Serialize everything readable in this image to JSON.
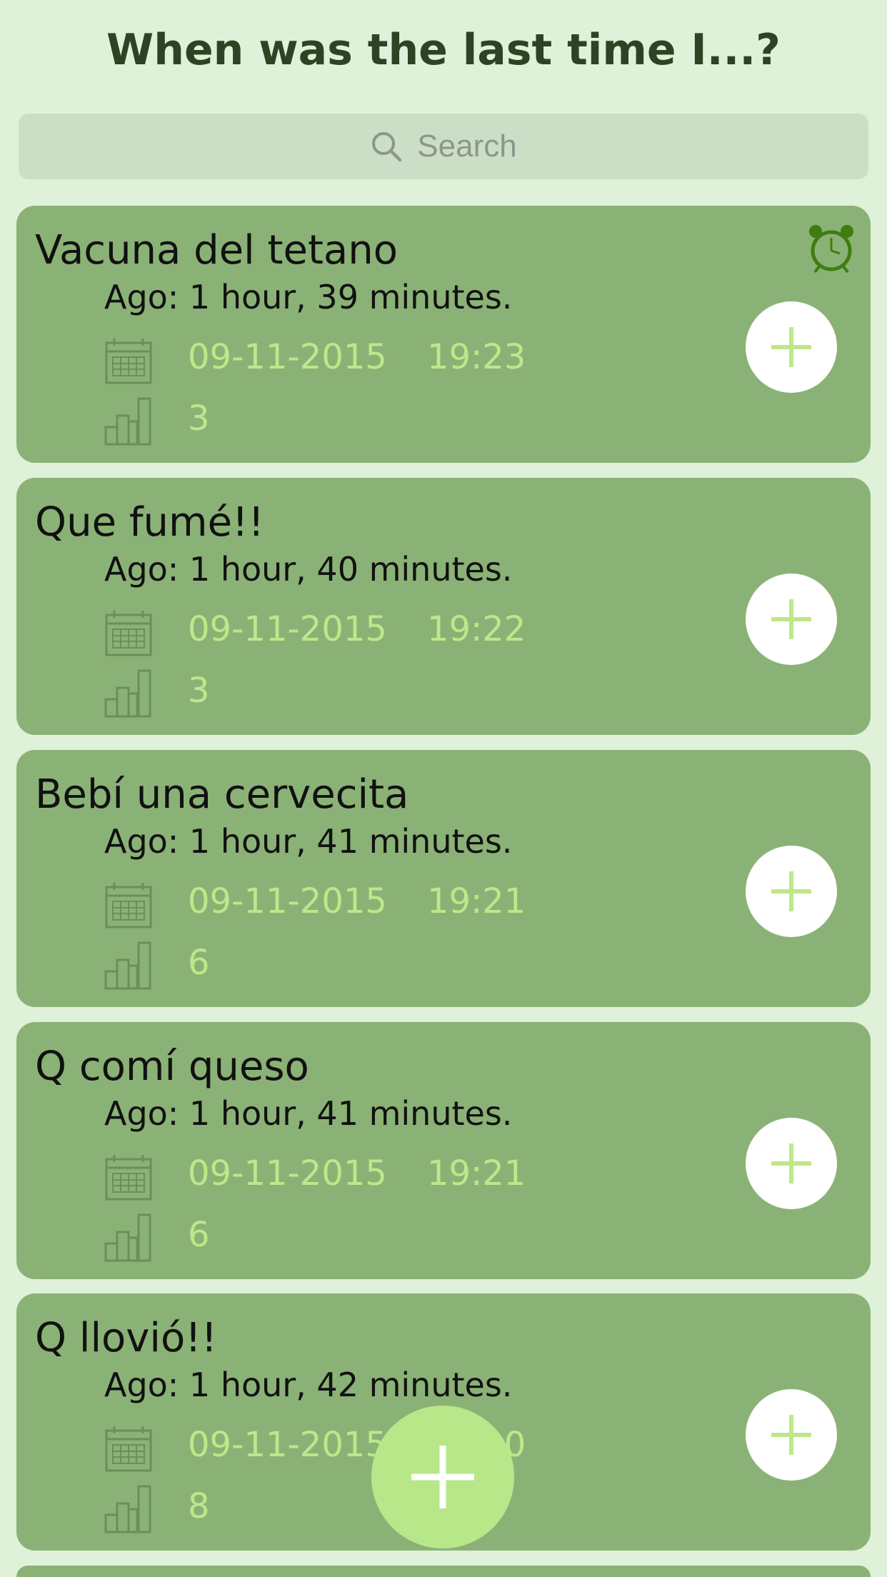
{
  "header": {
    "title": "When was the last time I...?"
  },
  "search": {
    "placeholder": "Search",
    "icon": "search-icon"
  },
  "items": [
    {
      "name": "Vacuna del tetano",
      "ago": "Ago: 1 hour, 39 minutes.",
      "date": "09-11-2015",
      "time": "19:23",
      "count": "3",
      "has_alarm": true
    },
    {
      "name": "Que fumé!!",
      "ago": "Ago: 1 hour, 40 minutes.",
      "date": "09-11-2015",
      "time": "19:22",
      "count": "3",
      "has_alarm": false
    },
    {
      "name": "Bebí una cervecita",
      "ago": "Ago: 1 hour, 41 minutes.",
      "date": "09-11-2015",
      "time": "19:21",
      "count": "6",
      "has_alarm": false
    },
    {
      "name": "Q comí queso",
      "ago": "Ago: 1 hour, 41 minutes.",
      "date": "09-11-2015",
      "time": "19:21",
      "count": "6",
      "has_alarm": false
    },
    {
      "name": "Q llovió!!",
      "ago": "Ago: 1 hour, 42 minutes.",
      "date": "09-11-2015",
      "time": "19:20",
      "count": "8",
      "has_alarm": false
    }
  ],
  "colors": {
    "background": "#dff1d9",
    "card": "#8bb276",
    "accent": "#bde88a",
    "fab": "#b8e78a",
    "title": "#2e4324"
  }
}
